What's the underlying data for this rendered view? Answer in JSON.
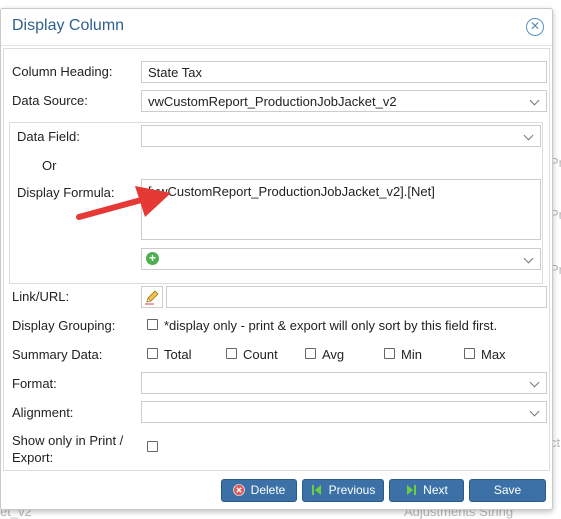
{
  "background": {
    "fragments": [
      "Pr",
      "Pr",
      "Pr",
      "ctio",
      "et_v2",
      "Adjustments String"
    ]
  },
  "dialog": {
    "title": "Display Column",
    "close_icon": "close-circle-icon"
  },
  "form": {
    "column_heading": {
      "label": "Column Heading:",
      "value": "State Tax"
    },
    "data_source": {
      "label": "Data Source:",
      "value": "vwCustomReport_ProductionJobJacket_v2"
    },
    "data_field": {
      "label": "Data Field:",
      "value": ""
    },
    "or_label": "Or",
    "display_formula": {
      "label": "Display Formula:",
      "value": "[vwCustomReport_ProductionJobJacket_v2].[Net]"
    },
    "formula_select": {
      "value": ""
    },
    "link_url": {
      "label": "Link/URL:",
      "value": ""
    },
    "display_grouping": {
      "label": "Display Grouping:",
      "note": "*display only - print & export will only sort by this field first."
    },
    "summary_data": {
      "label": "Summary Data:",
      "options": [
        "Total",
        "Count",
        "Avg",
        "Min",
        "Max"
      ]
    },
    "format": {
      "label": "Format:",
      "value": ""
    },
    "alignment": {
      "label": "Alignment:",
      "value": ""
    },
    "show_only_print": {
      "label_line1": "Show only in Print /",
      "label_line2": "Export:"
    }
  },
  "buttons": {
    "delete": "Delete",
    "previous": "Previous",
    "next": "Next",
    "save": "Save"
  },
  "colors": {
    "title": "#2e5f8e",
    "button": "#3c71a8",
    "annotation_arrow": "#e53935",
    "delete_icon": "#e05a5a",
    "nav_icon": "#6ccf3e"
  }
}
